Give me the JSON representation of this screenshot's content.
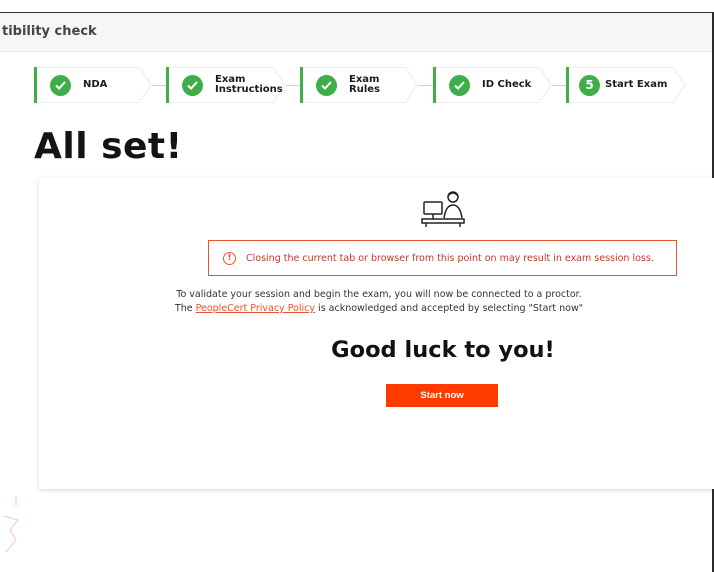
{
  "window": {
    "title": "tibility check"
  },
  "stepper": {
    "steps": [
      {
        "label": "NDA",
        "status": "completed"
      },
      {
        "label": "Exam\nInstructions",
        "status": "completed"
      },
      {
        "label": "Exam\nRules",
        "status": "completed"
      },
      {
        "label": "ID Check",
        "status": "completed"
      },
      {
        "number": "5",
        "label": "Start Exam",
        "status": "current"
      }
    ]
  },
  "main": {
    "heading": "All set!",
    "illustration_icon": "proctor-at-desk-icon",
    "warning": "Closing the current tab or browser from this point on may result in exam session loss.",
    "info_line1": "To validate your session and begin the exam, you will now be connected to a proctor.",
    "info_line2_pre": "The ",
    "privacy_link": "PeopleCert Privacy Policy",
    "info_line2_post": " is acknowledged and accepted by selecting \"Start now\"",
    "good_luck": "Good luck to you!",
    "start_button": "Start now"
  },
  "colors": {
    "accent": "#ff3b00",
    "success": "#3fae49",
    "warning_border": "#e8542e"
  }
}
